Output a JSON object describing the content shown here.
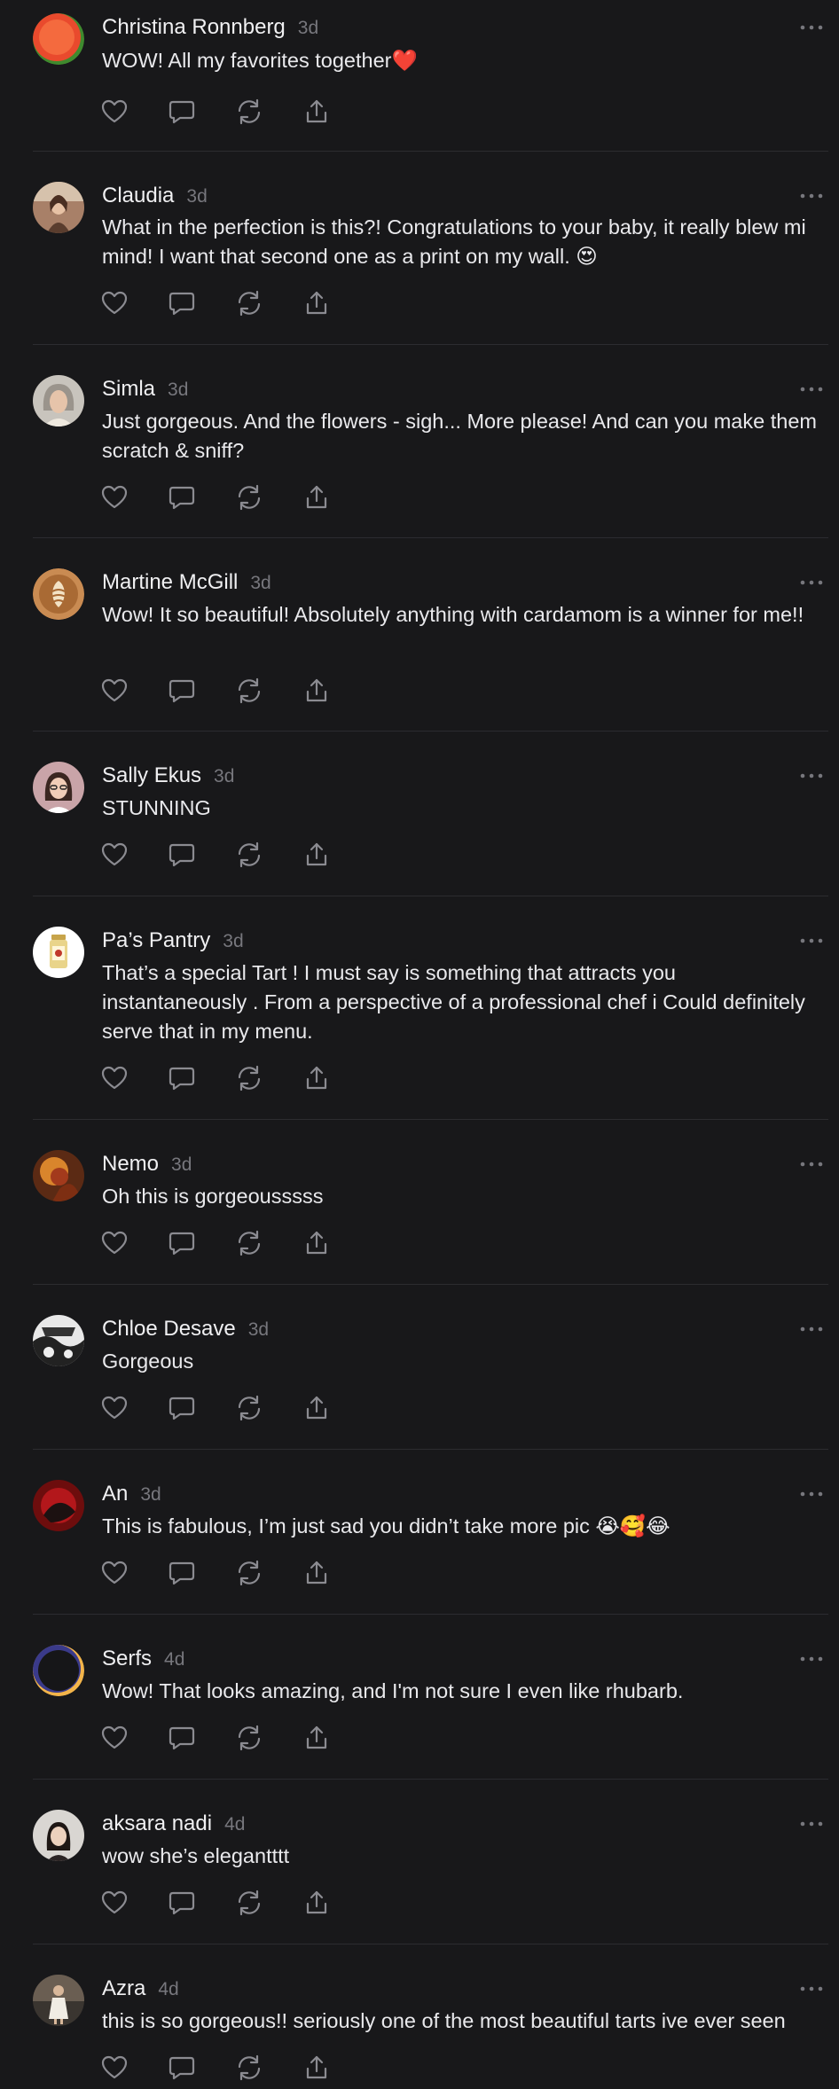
{
  "theme": {
    "background": "#18181a",
    "text": "#e9e9ec",
    "muted": "#77777d",
    "icon": "#8b8b91",
    "divider": "#2c2c30"
  },
  "comments": [
    {
      "name": "Christina Ronnberg",
      "time": "3d",
      "text": "WOW! All my favorites together❤️",
      "avatar": "orange-green-ring"
    },
    {
      "name": "Claudia",
      "time": "3d",
      "text": "What in the perfection is this?! Congratulations to your baby, it really blew mi mind! I want that second one as a print on my wall. 😍",
      "avatar": "portrait-brown"
    },
    {
      "name": "Simla",
      "time": "3d",
      "text": "Just gorgeous. And the flowers - sigh... More please! And can you make them scratch & sniff?",
      "avatar": "portrait-gray-hair"
    },
    {
      "name": "Martine McGill",
      "time": "3d",
      "text": "Wow! It so beautiful! Absolutely anything with cardamom is a winner for me!!",
      "avatar": "latte-art"
    },
    {
      "name": "Sally Ekus",
      "time": "3d",
      "text": "STUNNING",
      "avatar": "portrait-pink"
    },
    {
      "name": "Pa’s Pantry",
      "time": "3d",
      "text": "That’s a special Tart ! I must say is something that attracts you instantaneously . From a perspective of a professional chef i Could definitely serve that in my menu.",
      "avatar": "jar-logo"
    },
    {
      "name": "Nemo",
      "time": "3d",
      "text": "Oh this is gorgeousssss",
      "avatar": "painting-red"
    },
    {
      "name": "Chloe Desave",
      "time": "3d",
      "text": "Gorgeous",
      "avatar": "bw-pattern"
    },
    {
      "name": "An",
      "time": "3d",
      "text": "This is fabulous, I’m just sad you didn’t take more pic 😭🥰😂",
      "avatar": "dark-red"
    },
    {
      "name": "Serfs",
      "time": "4d",
      "text": "Wow! That looks amazing, and I'm not sure I even like rhubarb.",
      "avatar": "dark-ring"
    },
    {
      "name": "aksara nadi",
      "time": "4d",
      "text": "wow she’s elegantttt",
      "avatar": "portrait-dark-hair"
    },
    {
      "name": "Azra",
      "time": "4d",
      "text": "this is so gorgeous!! seriously one of the most beautiful tarts ive ever seen",
      "avatar": "figure-light"
    }
  ],
  "actions": [
    "heart-icon",
    "reply-icon",
    "restack-icon",
    "share-icon"
  ]
}
